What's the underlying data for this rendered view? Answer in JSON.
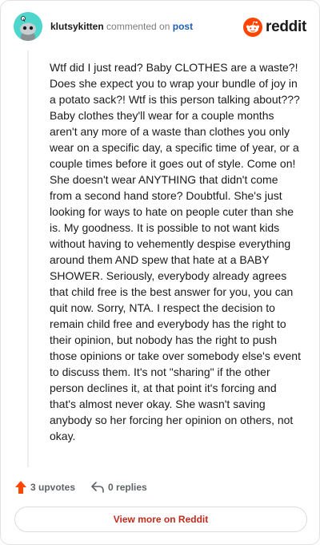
{
  "header": {
    "username": "klutsykitten",
    "action_text": "commented on",
    "post_link": "post",
    "brand_name": "reddit"
  },
  "comment": {
    "body": "Wtf did I just read? Baby CLOTHES are a waste?! Does she expect you to wrap your bundle of joy in a potato sack?! Wtf is this person talking about??? Baby clothes they'll wear for a couple months aren't any more of a waste than clothes you only wear on a specific day, a specific time of year, or a couple times before it goes out of style. Come on! She doesn't wear ANYTHING that didn't come from a second hand store? Doubtful. She's just looking for ways to hate on people cuter than she is. My goodness. It is possible to not want kids without having to vehemently despise everything around them AND spew that hate at a BABY SHOWER. Seriously, everybody already agrees that child free is the best answer for you, you can quit now. Sorry, NTA. I respect the decision to remain child free and everybody has the right to their opinion, but nobody has the right to push those opinions or take over somebody else's event to discuss them. It's not \"sharing\" if the other person declines it, at that point it's forcing and that's almost never okay. She wasn't saving anybody so her forcing her opinion on others, not okay."
  },
  "footer": {
    "upvotes_label": "3 upvotes",
    "replies_label": "0 replies",
    "view_more_label": "View more on Reddit"
  },
  "icons": {
    "avatar": "snoo-avatar-icon",
    "brand": "reddit-logo-icon",
    "upvote": "upvote-arrow-icon",
    "reply": "reply-arrow-icon"
  },
  "colors": {
    "avatar_bg": "#4fd6cc",
    "reddit_orange": "#ff4500",
    "link_blue": "#1c5fb0",
    "view_more_red": "#c12b1b",
    "muted_gray": "#7c7c7c"
  }
}
